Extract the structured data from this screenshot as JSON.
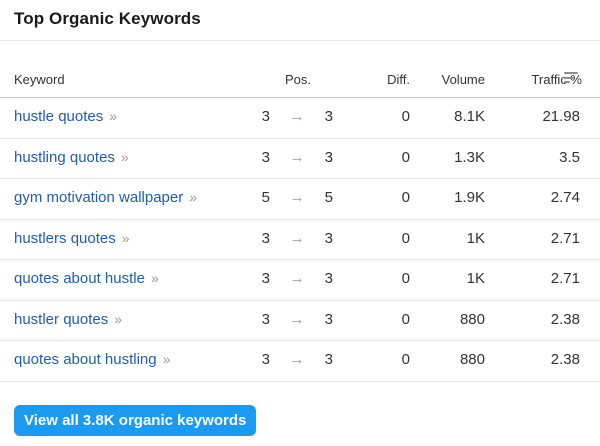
{
  "panel": {
    "title": "Top Organic Keywords"
  },
  "table": {
    "headers": {
      "keyword": "Keyword",
      "pos": "Pos.",
      "diff": "Diff.",
      "volume": "Volume",
      "traffic": "Traffic %"
    },
    "arrow_glyph": "→",
    "chevron_glyph": "»",
    "rows": [
      {
        "keyword": "hustle quotes",
        "pos_prev": "3",
        "pos_curr": "3",
        "diff": "0",
        "volume": "8.1K",
        "traffic": "21.98"
      },
      {
        "keyword": "hustling quotes",
        "pos_prev": "3",
        "pos_curr": "3",
        "diff": "0",
        "volume": "1.3K",
        "traffic": "3.5"
      },
      {
        "keyword": "gym motivation wallpaper",
        "pos_prev": "5",
        "pos_curr": "5",
        "diff": "0",
        "volume": "1.9K",
        "traffic": "2.74"
      },
      {
        "keyword": "hustlers quotes",
        "pos_prev": "3",
        "pos_curr": "3",
        "diff": "0",
        "volume": "1K",
        "traffic": "2.71"
      },
      {
        "keyword": "quotes about hustle",
        "pos_prev": "3",
        "pos_curr": "3",
        "diff": "0",
        "volume": "1K",
        "traffic": "2.71"
      },
      {
        "keyword": "hustler quotes",
        "pos_prev": "3",
        "pos_curr": "3",
        "diff": "0",
        "volume": "880",
        "traffic": "2.38"
      },
      {
        "keyword": "quotes about hustling",
        "pos_prev": "3",
        "pos_curr": "3",
        "diff": "0",
        "volume": "880",
        "traffic": "2.38"
      }
    ]
  },
  "footer": {
    "cta_label": "View all 3.8K organic keywords"
  },
  "colors": {
    "link": "#1f5fa8",
    "button": "#1a9af0",
    "arrow": "#9a9a9a"
  },
  "icons": {
    "sort": "sort-descending-icon",
    "arrow": "arrow-right-icon",
    "chevron": "double-chevron-right-icon"
  }
}
